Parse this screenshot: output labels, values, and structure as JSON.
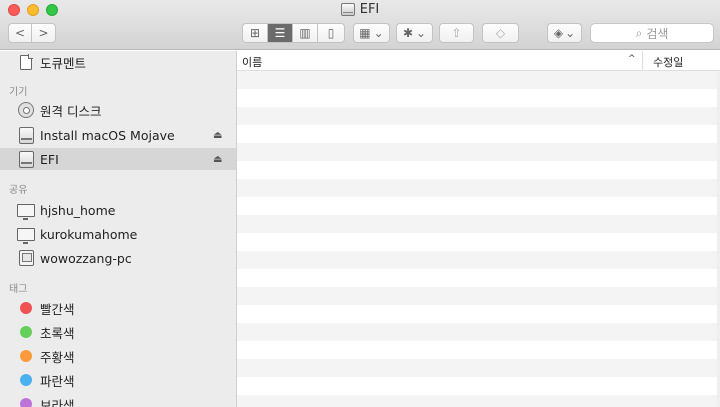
{
  "window": {
    "title": "EFI"
  },
  "toolbar": {
    "back": "<",
    "forward": ">",
    "view_icon": "⊞",
    "view_list": "☰",
    "view_columns": "▥",
    "view_gallery": "▯",
    "group_icon": "▦",
    "group_caret": "⌄",
    "action_icon": "✱",
    "action_caret": "⌄",
    "share_icon": "⇧",
    "tag_icon": "◇",
    "dropbox_icon": "◈",
    "dropbox_caret": "⌄",
    "search_icon": "⌕",
    "search_placeholder": "검색"
  },
  "sidebar": {
    "top_item": "도큐멘트",
    "devices_header": "기기",
    "devices": [
      {
        "label": "원격 디스크"
      },
      {
        "label": "Install macOS Mojave",
        "eject": "⏏"
      },
      {
        "label": "EFI",
        "eject": "⏏"
      }
    ],
    "shared_header": "공유",
    "shared": [
      {
        "label": "hjshu_home"
      },
      {
        "label": "kurokumahome"
      },
      {
        "label": "wowozzang-pc"
      }
    ],
    "tags_header": "태그",
    "tags": [
      {
        "label": "빨간색",
        "color": "#f05252"
      },
      {
        "label": "초록색",
        "color": "#66cf5a"
      },
      {
        "label": "주황색",
        "color": "#f99b3d"
      },
      {
        "label": "파란색",
        "color": "#4ab0ef"
      },
      {
        "label": "보라색",
        "color": "#bd74d8"
      }
    ]
  },
  "content": {
    "col_name": "이름",
    "sort_arrow": "^",
    "col_modified": "수정일"
  }
}
